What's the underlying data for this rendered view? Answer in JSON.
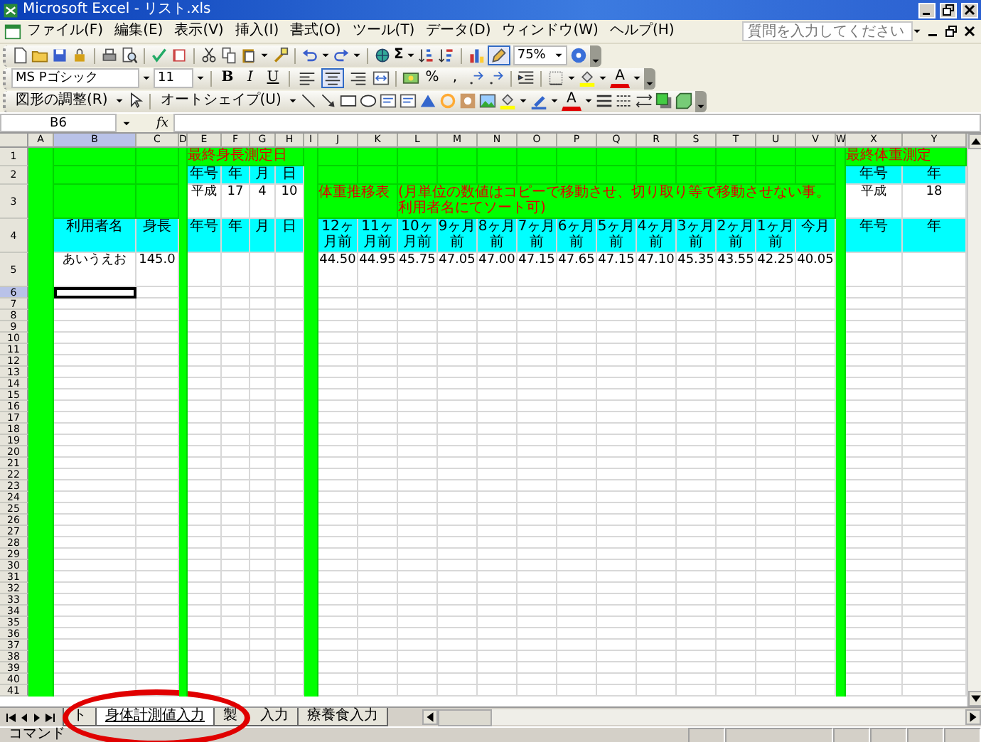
{
  "window": {
    "title": "Microsoft Excel - リスト.xls"
  },
  "menu": [
    {
      "label": "ファイル(F)"
    },
    {
      "label": "編集(E)"
    },
    {
      "label": "表示(V)"
    },
    {
      "label": "挿入(I)"
    },
    {
      "label": "書式(O)"
    },
    {
      "label": "ツール(T)"
    },
    {
      "label": "データ(D)"
    },
    {
      "label": "ウィンドウ(W)"
    },
    {
      "label": "ヘルプ(H)"
    }
  ],
  "help_search": {
    "placeholder": "質問を入力してください"
  },
  "standard_toolbar": {
    "sum": "Σ",
    "drawing_button": {
      "selected": true
    },
    "zoom": "75%"
  },
  "formatting_toolbar": {
    "font": "MS Pゴシック",
    "size": "11",
    "bold": "B",
    "italic": "I",
    "underline": "U",
    "align": [
      {
        "selected": false
      },
      {
        "selected": true
      },
      {
        "selected": false
      }
    ],
    "percent": "%",
    "comma": ",",
    "font_color": "A"
  },
  "drawing_toolbar": {
    "draw_menu": "図形の調整(R)",
    "autoshapes": "オートシェイプ(U)",
    "font_color": "A"
  },
  "formula_bar": {
    "name_box": "B6",
    "function_label": "fx"
  },
  "sheet": {
    "columns": [
      {
        "label": "A",
        "band": true,
        "selected": false
      },
      {
        "label": "B",
        "band": false,
        "selected": true
      },
      {
        "label": "C",
        "band": false,
        "selected": false
      },
      {
        "label": "D",
        "band": true,
        "selected": false
      },
      {
        "label": "E",
        "band": false,
        "selected": false
      },
      {
        "label": "F",
        "band": false,
        "selected": false
      },
      {
        "label": "G",
        "band": false,
        "selected": false
      },
      {
        "label": "H",
        "band": false,
        "selected": false
      },
      {
        "label": "I",
        "band": true,
        "selected": false
      },
      {
        "label": "J",
        "band": false,
        "selected": false
      },
      {
        "label": "K",
        "band": false,
        "selected": false
      },
      {
        "label": "L",
        "band": false,
        "selected": false
      },
      {
        "label": "M",
        "band": false,
        "selected": false
      },
      {
        "label": "N",
        "band": false,
        "selected": false
      },
      {
        "label": "O",
        "band": false,
        "selected": false
      },
      {
        "label": "P",
        "band": false,
        "selected": false
      },
      {
        "label": "Q",
        "band": false,
        "selected": false
      },
      {
        "label": "R",
        "band": false,
        "selected": false
      },
      {
        "label": "S",
        "band": false,
        "selected": false
      },
      {
        "label": "T",
        "band": false,
        "selected": false
      },
      {
        "label": "U",
        "band": false,
        "selected": false
      },
      {
        "label": "V",
        "band": false,
        "selected": false
      },
      {
        "label": "W",
        "band": true,
        "selected": false
      },
      {
        "label": "X",
        "band": false,
        "selected": false
      },
      {
        "label": "Y",
        "band": false,
        "selected": false
      }
    ],
    "rows": [
      {
        "number": "1",
        "selected": false,
        "cells": [
          null,
          {
            "kind": "band"
          },
          {
            "kind": "band"
          },
          null,
          {
            "kind": "title",
            "text": "最終身長測定日",
            "overflow": true
          },
          {
            "kind": "band"
          },
          {
            "kind": "band"
          },
          {
            "kind": "band"
          },
          null,
          {
            "kind": "band"
          },
          {
            "kind": "band"
          },
          {
            "kind": "band"
          },
          {
            "kind": "band"
          },
          {
            "kind": "band"
          },
          {
            "kind": "band"
          },
          {
            "kind": "band"
          },
          {
            "kind": "band"
          },
          {
            "kind": "band"
          },
          {
            "kind": "band"
          },
          {
            "kind": "band"
          },
          {
            "kind": "band"
          },
          {
            "kind": "band"
          },
          null,
          {
            "kind": "title",
            "text": "最終体重測定",
            "overflow": true
          },
          {
            "kind": "band"
          }
        ]
      },
      {
        "number": "2",
        "selected": false,
        "cells": [
          null,
          {
            "kind": "band"
          },
          {
            "kind": "band"
          },
          null,
          {
            "kind": "header",
            "text": "年号"
          },
          {
            "kind": "header",
            "text": "年"
          },
          {
            "kind": "header",
            "text": "月"
          },
          {
            "kind": "header",
            "text": "日"
          },
          null,
          {
            "kind": "band"
          },
          {
            "kind": "band"
          },
          {
            "kind": "band"
          },
          {
            "kind": "band"
          },
          {
            "kind": "band"
          },
          {
            "kind": "band"
          },
          {
            "kind": "band"
          },
          {
            "kind": "band"
          },
          {
            "kind": "band"
          },
          {
            "kind": "band"
          },
          {
            "kind": "band"
          },
          {
            "kind": "band"
          },
          {
            "kind": "band"
          },
          null,
          {
            "kind": "header",
            "text": "年号"
          },
          {
            "kind": "header",
            "text": "年"
          }
        ]
      },
      {
        "number": "3",
        "selected": false,
        "cells": [
          null,
          {
            "kind": "band"
          },
          {
            "kind": "band"
          },
          null,
          {
            "kind": "value",
            "text": "平成"
          },
          {
            "kind": "value",
            "text": "17"
          },
          {
            "kind": "value",
            "text": "4"
          },
          {
            "kind": "value",
            "text": "10"
          },
          null,
          {
            "kind": "title",
            "text": "体重推移表",
            "overflow": true
          },
          {
            "kind": "band"
          },
          {
            "kind": "note",
            "text": "(月単位の数値はコピーで移動させ、切り取り等で移動させない事。利用者名にてソート可)",
            "overflow": true
          },
          {
            "kind": "band"
          },
          {
            "kind": "band"
          },
          {
            "kind": "band"
          },
          {
            "kind": "band"
          },
          {
            "kind": "band"
          },
          {
            "kind": "band"
          },
          {
            "kind": "band"
          },
          {
            "kind": "band"
          },
          {
            "kind": "band"
          },
          {
            "kind": "band"
          },
          null,
          {
            "kind": "value",
            "text": "平成"
          },
          {
            "kind": "value",
            "text": "18"
          }
        ]
      },
      {
        "number": "4",
        "selected": false,
        "cells": [
          null,
          {
            "kind": "header",
            "text": "利用者名"
          },
          {
            "kind": "header",
            "text": "身長"
          },
          null,
          {
            "kind": "header",
            "text": "年号"
          },
          {
            "kind": "header",
            "text": "年"
          },
          {
            "kind": "header",
            "text": "月"
          },
          {
            "kind": "header",
            "text": "日"
          },
          null,
          {
            "kind": "header",
            "text": "12ヶ月前"
          },
          {
            "kind": "header",
            "text": "11ヶ月前"
          },
          {
            "kind": "header",
            "text": "10ヶ月前"
          },
          {
            "kind": "header",
            "text": "9ヶ月前"
          },
          {
            "kind": "header",
            "text": "8ヶ月前"
          },
          {
            "kind": "header",
            "text": "7ヶ月前"
          },
          {
            "kind": "header",
            "text": "6ヶ月前"
          },
          {
            "kind": "header",
            "text": "5ヶ月前"
          },
          {
            "kind": "header",
            "text": "4ヶ月前"
          },
          {
            "kind": "header",
            "text": "3ヶ月前"
          },
          {
            "kind": "header",
            "text": "2ヶ月前"
          },
          {
            "kind": "header",
            "text": "1ヶ月前"
          },
          {
            "kind": "header",
            "text": "今月"
          },
          null,
          {
            "kind": "header",
            "text": "年号"
          },
          {
            "kind": "header",
            "text": "年"
          }
        ]
      },
      {
        "number": "5",
        "selected": false,
        "cells": [
          null,
          {
            "kind": "value",
            "text": "あいうえお"
          },
          {
            "kind": "value",
            "text": "145.0"
          },
          null,
          {
            "kind": "blank"
          },
          {
            "kind": "blank"
          },
          {
            "kind": "blank"
          },
          {
            "kind": "blank"
          },
          null,
          {
            "kind": "value",
            "text": "44.50"
          },
          {
            "kind": "value",
            "text": "44.95"
          },
          {
            "kind": "value",
            "text": "45.75"
          },
          {
            "kind": "value",
            "text": "47.05"
          },
          {
            "kind": "value",
            "text": "47.00"
          },
          {
            "kind": "value",
            "text": "47.15"
          },
          {
            "kind": "value",
            "text": "47.65"
          },
          {
            "kind": "value",
            "text": "47.15"
          },
          {
            "kind": "value",
            "text": "47.10"
          },
          {
            "kind": "value",
            "text": "45.35"
          },
          {
            "kind": "value",
            "text": "43.55"
          },
          {
            "kind": "value",
            "text": "42.25"
          },
          {
            "kind": "value",
            "text": "40.05"
          },
          null,
          {
            "kind": "blank"
          },
          {
            "kind": "blank"
          }
        ]
      },
      {
        "number": "6",
        "selected": true
      },
      {
        "number": "7",
        "selected": false
      },
      {
        "number": "8",
        "selected": false
      },
      {
        "number": "9",
        "selected": false
      },
      {
        "number": "10",
        "selected": false
      },
      {
        "number": "11",
        "selected": false
      },
      {
        "number": "12",
        "selected": false
      },
      {
        "number": "13",
        "selected": false
      },
      {
        "number": "14",
        "selected": false
      },
      {
        "number": "15",
        "selected": false
      },
      {
        "number": "16",
        "selected": false
      },
      {
        "number": "17",
        "selected": false
      },
      {
        "number": "18",
        "selected": false
      },
      {
        "number": "19",
        "selected": false
      },
      {
        "number": "20",
        "selected": false
      },
      {
        "number": "21",
        "selected": false
      },
      {
        "number": "22",
        "selected": false
      },
      {
        "number": "23",
        "selected": false
      },
      {
        "number": "24",
        "selected": false
      },
      {
        "number": "25",
        "selected": false
      },
      {
        "number": "26",
        "selected": false
      },
      {
        "number": "27",
        "selected": false
      },
      {
        "number": "28",
        "selected": false
      },
      {
        "number": "29",
        "selected": false
      },
      {
        "number": "30",
        "selected": false
      },
      {
        "number": "31",
        "selected": false
      },
      {
        "number": "32",
        "selected": false
      },
      {
        "number": "33",
        "selected": false
      },
      {
        "number": "34",
        "selected": false
      },
      {
        "number": "35",
        "selected": false
      },
      {
        "number": "36",
        "selected": false
      },
      {
        "number": "37",
        "selected": false
      },
      {
        "number": "38",
        "selected": false
      },
      {
        "number": "39",
        "selected": false
      },
      {
        "number": "40",
        "selected": false
      },
      {
        "number": "41",
        "selected": false
      }
    ]
  },
  "sheet_tabs": [
    {
      "label": "ト",
      "selected": false
    },
    {
      "label": "身体計測値入力",
      "selected": true
    },
    {
      "label": "製",
      "label_after": "入力",
      "selected": false
    },
    {
      "label": "療養食入力",
      "selected": false
    }
  ],
  "status_bar": {
    "text": "コマンド"
  }
}
